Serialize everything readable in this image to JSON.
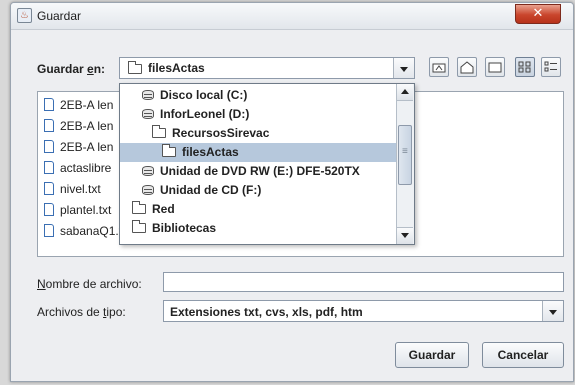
{
  "window": {
    "title": "Guardar",
    "close_label": "✕"
  },
  "save_in": {
    "label_prefix": "Guardar ",
    "label_mnemonic": "e",
    "label_suffix": "n:",
    "selected": "filesActas"
  },
  "toolbar": {
    "icons": [
      "up-one-level-icon",
      "home-icon",
      "new-folder-icon",
      "list-view-icon",
      "details-view-icon"
    ]
  },
  "file_list": {
    "items": [
      "2EB-A len",
      "2EB-A len",
      "2EB-A len",
      "actaslibre",
      "nivel.txt",
      "plantel.txt",
      "sabanaQ1.txt"
    ]
  },
  "dropdown": {
    "items": [
      {
        "label": "Disco local (C:)",
        "icon": "drive-icon",
        "selected": false
      },
      {
        "label": "InforLeonel (D:)",
        "icon": "drive-icon",
        "selected": false
      },
      {
        "label": "RecursosSirevac",
        "icon": "folder-icon",
        "selected": false
      },
      {
        "label": "filesActas",
        "icon": "folder-icon",
        "selected": true
      },
      {
        "label": "Unidad de DVD RW (E:) DFE-520TX",
        "icon": "drive-icon",
        "selected": false
      },
      {
        "label": "Unidad de CD (F:)",
        "icon": "drive-icon",
        "selected": false
      },
      {
        "label": "Red",
        "icon": "folder-icon",
        "selected": false
      },
      {
        "label": "Bibliotecas",
        "icon": "folder-icon",
        "selected": false
      }
    ]
  },
  "filename": {
    "label_mnemonic": "N",
    "label_rest": "ombre de archivo:",
    "value": ""
  },
  "filetype": {
    "label_prefix": "Archivos de ",
    "label_mnemonic": "t",
    "label_suffix": "ipo:",
    "value": "Extensiones txt, cvs, xls, pdf, htm"
  },
  "buttons": {
    "save": "Guardar",
    "cancel": "Cancelar"
  }
}
